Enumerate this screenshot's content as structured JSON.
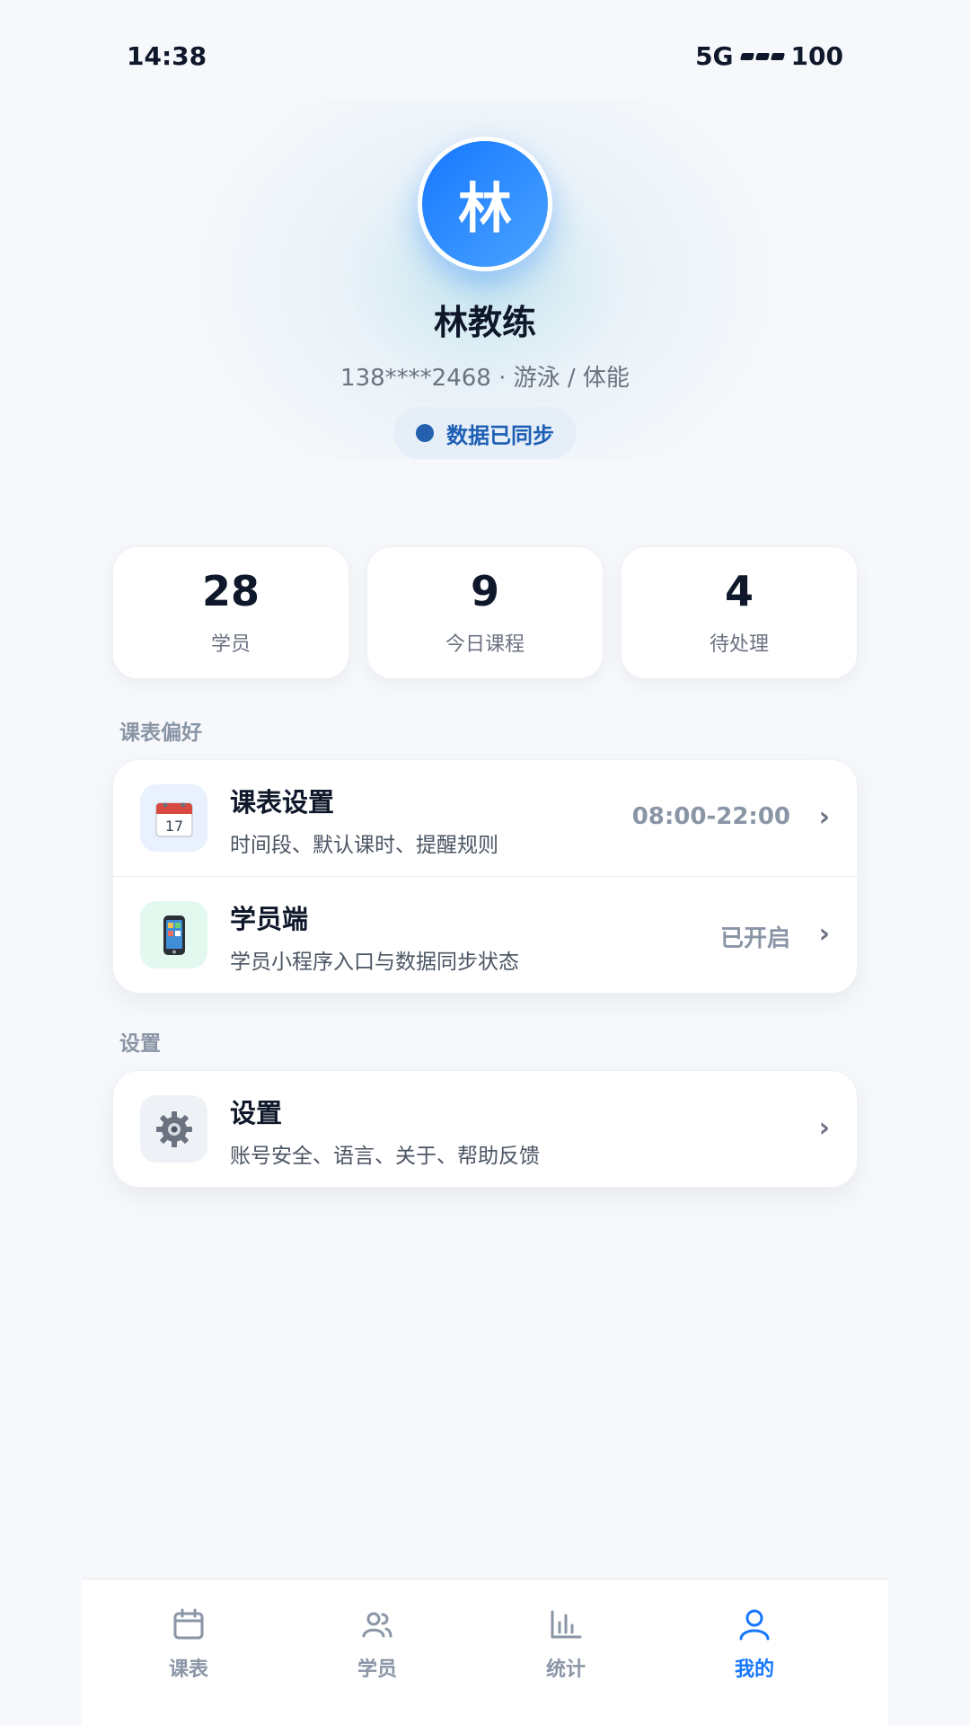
{
  "status_bar": {
    "time": "14:38",
    "network": "5G",
    "battery": "100"
  },
  "profile": {
    "avatar_char": "林",
    "name": "林教练",
    "info": "138****2468 · 游泳 / 体能",
    "sync_status": "数据已同步"
  },
  "stats": [
    {
      "value": "28",
      "label": "学员"
    },
    {
      "value": "9",
      "label": "今日课程"
    },
    {
      "value": "4",
      "label": "待处理"
    }
  ],
  "sections": {
    "schedule_prefs": {
      "title": "课表偏好",
      "items": [
        {
          "icon": "calendar-icon",
          "title": "课表设置",
          "desc": "时间段、默认课时、提醒规则",
          "value": "08:00-22:00"
        },
        {
          "icon": "mobile-phone-icon",
          "title": "学员端",
          "desc": "学员小程序入口与数据同步状态",
          "value": "已开启"
        }
      ]
    },
    "settings": {
      "title": "设置",
      "items": [
        {
          "icon": "gear-icon",
          "title": "设置",
          "desc": "账号安全、语言、关于、帮助反馈"
        }
      ]
    }
  },
  "tabbar": [
    {
      "icon": "calendar-icon",
      "label": "课表"
    },
    {
      "icon": "users-icon",
      "label": "学员"
    },
    {
      "icon": "bar-chart-icon",
      "label": "统计"
    },
    {
      "icon": "user-icon",
      "label": "我的",
      "active": true
    }
  ],
  "colors": {
    "accent": "#1677ff",
    "muted": "#8a95a6",
    "sync_dot": "#2360ad"
  }
}
